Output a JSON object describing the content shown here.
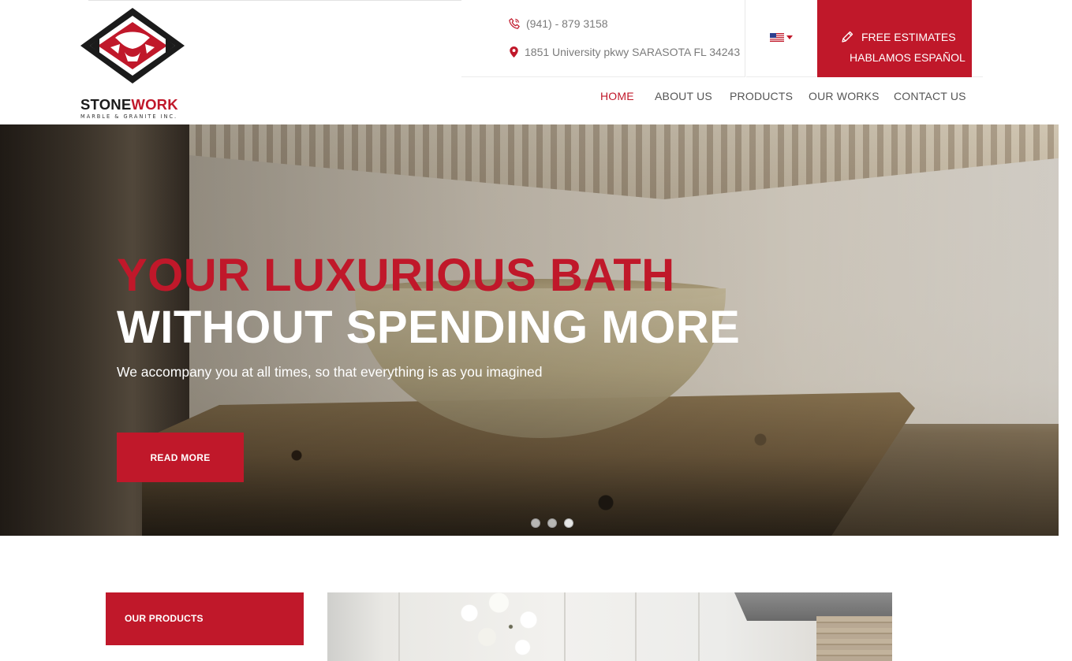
{
  "brand": {
    "name_part1": "STONE",
    "name_part2": "WORK",
    "tagline": "MARBLE & GRANITE INC.",
    "accent_color": "#c0182a"
  },
  "contact": {
    "phone": "(941) - 879 3158",
    "address": "1851 University pkwy SARASOTA FL 34243",
    "phone_icon": "phone-icon",
    "address_icon": "map-pin-icon"
  },
  "language": {
    "selected_flag": "us-flag-icon"
  },
  "estimate": {
    "line1": "FREE ESTIMATES",
    "line2": "HABLAMOS ESPAÑOL",
    "icon": "pencil-icon"
  },
  "nav": {
    "items": [
      {
        "label": "HOME",
        "active": true
      },
      {
        "label": "ABOUT US",
        "active": false
      },
      {
        "label": "PRODUCTS",
        "active": false
      },
      {
        "label": "OUR WORKS",
        "active": false
      },
      {
        "label": "CONTACT US",
        "active": false
      }
    ]
  },
  "hero": {
    "title_line1": "YOUR LUXURIOUS BATH",
    "title_line2": "WITHOUT SPENDING MORE",
    "subtitle": "We accompany you at all times, so that everything is as you imagined",
    "button_label": "READ MORE",
    "slide_count": 3,
    "active_slide": 3
  },
  "products": {
    "heading": "OUR PRODUCTS"
  }
}
